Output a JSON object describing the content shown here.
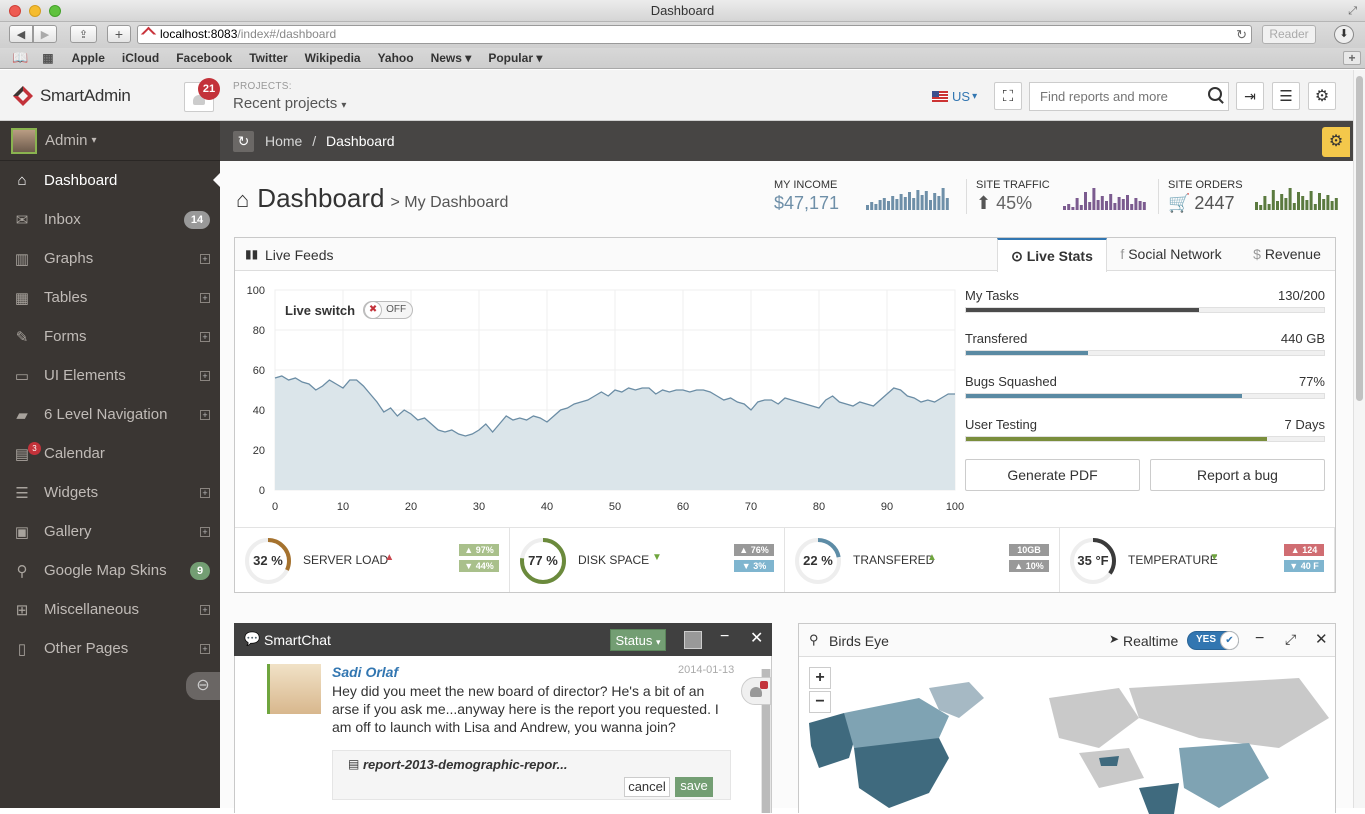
{
  "browser": {
    "window_title": "Dashboard",
    "url_host": "localhost:8083",
    "url_path": "/index#/dashboard",
    "reader_label": "Reader",
    "bookmarks": [
      "Apple",
      "iCloud",
      "Facebook",
      "Twitter",
      "Wikipedia",
      "Yahoo",
      "News ▾",
      "Popular ▾"
    ]
  },
  "header": {
    "logo_text": "SmartAdmin",
    "notifications_count": "21",
    "projects_label": "PROJECTS:",
    "projects_value": "Recent projects",
    "lang_label": "US",
    "search_placeholder": "Find reports and more"
  },
  "sidebar": {
    "user_name": "Admin",
    "items": [
      {
        "label": "Dashboard",
        "icon": "home-icon",
        "glyph": "⌂"
      },
      {
        "label": "Inbox",
        "icon": "inbox-icon",
        "glyph": "✉",
        "badge": "14"
      },
      {
        "label": "Graphs",
        "icon": "bar-chart-icon",
        "glyph": "▥"
      },
      {
        "label": "Tables",
        "icon": "table-icon",
        "glyph": "▦"
      },
      {
        "label": "Forms",
        "icon": "pencil-square-icon",
        "glyph": "✎"
      },
      {
        "label": "UI Elements",
        "icon": "monitor-icon",
        "glyph": "▭"
      },
      {
        "label": "6 Level Navigation",
        "icon": "folder-open-icon",
        "glyph": "▰"
      },
      {
        "label": "Calendar",
        "icon": "calendar-icon",
        "glyph": "▤",
        "count": "3"
      },
      {
        "label": "Widgets",
        "icon": "list-alt-icon",
        "glyph": "☰"
      },
      {
        "label": "Gallery",
        "icon": "picture-icon",
        "glyph": "▣"
      },
      {
        "label": "Google Map Skins",
        "icon": "map-marker-icon",
        "glyph": "⚲",
        "badge": "9"
      },
      {
        "label": "Miscellaneous",
        "icon": "windows-icon",
        "glyph": "⊞"
      },
      {
        "label": "Other Pages",
        "icon": "file-icon",
        "glyph": "▯"
      }
    ]
  },
  "breadcrumb": {
    "home": "Home",
    "separator": "/",
    "current": "Dashboard"
  },
  "page": {
    "title": "Dashboard",
    "subtitle": "> My Dashboard",
    "stats": [
      {
        "label": "MY INCOME",
        "value": "$47,171",
        "color": "#6e8fa8"
      },
      {
        "label": "SITE TRAFFIC",
        "value": "45%",
        "color": "#7b5b8f"
      },
      {
        "label": "SITE ORDERS",
        "value": "2447",
        "color": "#5b7a3f"
      }
    ]
  },
  "live_feeds": {
    "title": "Live Feeds",
    "tabs": [
      "Live Stats",
      "Social Network",
      "Revenue"
    ],
    "live_switch_label": "Live switch",
    "live_switch_state": "OFF",
    "tasks": [
      {
        "label": "My Tasks",
        "value": "130/200",
        "fill": 0.65,
        "color": "#4b4b4b"
      },
      {
        "label": "Transfered",
        "value": "440 GB",
        "fill": 0.34,
        "color": "#5a8aa3"
      },
      {
        "label": "Bugs Squashed",
        "value": "77%",
        "fill": 0.77,
        "color": "#5a8aa3"
      },
      {
        "label": "User Testing",
        "value": "7 Days",
        "fill": 0.84,
        "color": "#7a8e3c"
      }
    ],
    "generate_pdf": "Generate PDF",
    "report_bug": "Report a bug",
    "gauges": [
      {
        "value": "32 %",
        "label": "SERVER LOAD",
        "dir": "up",
        "dir_color": "#c9474f",
        "up": "▲ 97%",
        "down": "▼ 44%",
        "up_color": "#a9c08b",
        "down_color": "#a9c08b",
        "ring": "#a5722e",
        "pct": 0.32
      },
      {
        "value": "77 %",
        "label": "DISK SPACE",
        "dir": "down",
        "dir_color": "#6fa53e",
        "up": "▲ 76%",
        "down": "▼ 3%",
        "up_color": "#999999",
        "down_color": "#7fb5cf",
        "ring": "#6b8a3c",
        "pct": 0.77
      },
      {
        "value": "22 %",
        "label": "TRANSFERED",
        "dir": "up",
        "dir_color": "#6fa53e",
        "up": "10GB",
        "down": "▲ 10%",
        "up_color": "#999999",
        "down_color": "#999999",
        "ring": "#5d8ca6",
        "pct": 0.22
      },
      {
        "value": "35 °F",
        "label": "TEMPERATURE",
        "dir": "down",
        "dir_color": "#6fa53e",
        "up": "▲ 124",
        "down": "▼ 40 F",
        "up_color": "#d06d72",
        "down_color": "#7fb5cf",
        "ring": "#3a3a3a",
        "pct": 0.35
      }
    ]
  },
  "chart_data": {
    "type": "area",
    "xlim": [
      0,
      100
    ],
    "ylim": [
      0,
      100
    ],
    "x_ticks": [
      0,
      10,
      20,
      30,
      40,
      50,
      60,
      70,
      80,
      90,
      100
    ],
    "y_ticks": [
      0,
      20,
      40,
      60,
      80,
      100
    ],
    "x": [
      0,
      1,
      2,
      3,
      4,
      5,
      6,
      7,
      8,
      9,
      10,
      11,
      12,
      13,
      14,
      15,
      16,
      17,
      18,
      19,
      20,
      21,
      22,
      23,
      24,
      25,
      26,
      27,
      28,
      29,
      30,
      31,
      32,
      33,
      34,
      35,
      36,
      37,
      38,
      39,
      40,
      41,
      42,
      43,
      44,
      45,
      46,
      47,
      48,
      49,
      50,
      51,
      52,
      53,
      54,
      55,
      56,
      57,
      58,
      59,
      60,
      61,
      62,
      63,
      64,
      65,
      66,
      67,
      68,
      69,
      70,
      71,
      72,
      73,
      74,
      75,
      76,
      77,
      78,
      79,
      80,
      81,
      82,
      83,
      84,
      85,
      86,
      87,
      88,
      89,
      90,
      91,
      92,
      93,
      94,
      95,
      96,
      97,
      98,
      99,
      100
    ],
    "values": [
      56,
      57,
      55,
      56,
      54,
      53,
      50,
      52,
      55,
      53,
      51,
      55,
      55,
      52,
      48,
      44,
      39,
      41,
      37,
      40,
      38,
      35,
      36,
      33,
      30,
      29,
      30,
      28,
      27,
      28,
      30,
      33,
      29,
      33,
      37,
      35,
      36,
      35,
      37,
      36,
      34,
      37,
      40,
      41,
      43,
      44,
      45,
      47,
      49,
      47,
      50,
      49,
      51,
      50,
      51,
      51,
      48,
      50,
      49,
      50,
      50,
      49,
      50,
      50,
      49,
      47,
      45,
      46,
      44,
      43,
      40,
      44,
      45,
      45,
      43,
      46,
      45,
      44,
      43,
      42,
      41,
      45,
      47,
      44,
      43,
      42,
      44,
      43,
      42,
      45,
      48,
      51,
      50,
      47,
      46,
      44,
      45,
      44,
      46,
      48,
      48
    ],
    "line_color": "#6b8da5",
    "fill_color": "#dbe5ea"
  },
  "smartchat": {
    "title": "SmartChat",
    "status_label": "Status",
    "sender": "Sadi Orlaf",
    "date": "2014-01-13",
    "message": "Hey did you meet the new board of director? He's a bit of an arse if you ask me...anyway here is the report you requested. I am off to launch with Lisa and Andrew, you wanna join?",
    "file_name": "report-2013-demographic-repor...",
    "cancel_label": "cancel",
    "save_label": "save"
  },
  "birds_eye": {
    "title": "Birds Eye",
    "realtime_label": "Realtime",
    "realtime_state": "YES"
  }
}
